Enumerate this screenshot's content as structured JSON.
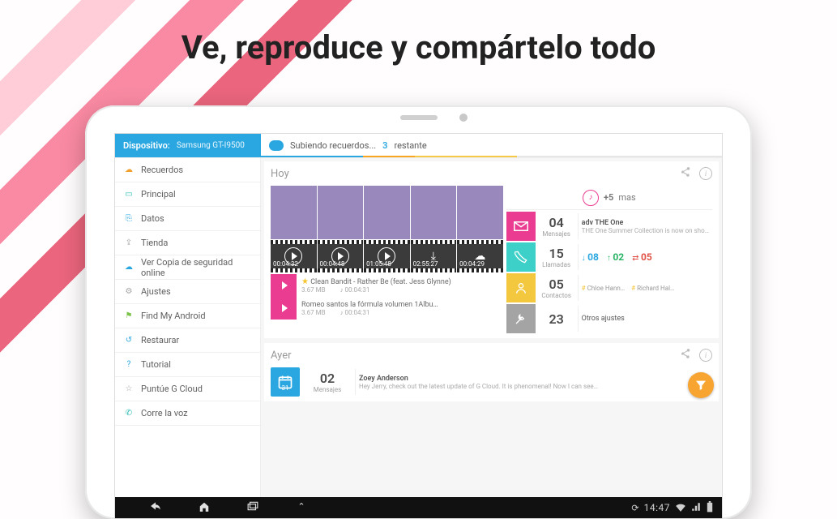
{
  "headline": "Ve, reproduce y compártelo todo",
  "header": {
    "device_label": "Dispositivo:",
    "device_name": "Samsung GT-I9500",
    "upload_prefix": "Subiendo recuerdos...",
    "upload_count": "3",
    "upload_suffix": "restante"
  },
  "sidebar": {
    "items": [
      {
        "icon": "☁",
        "color": "ico-orange",
        "label": "Recuerdos"
      },
      {
        "icon": "▭",
        "color": "ico-teal",
        "label": "Principal"
      },
      {
        "icon": "⎘",
        "color": "ico-blue",
        "label": "Datos"
      },
      {
        "icon": "⇪",
        "color": "ico-gray",
        "label": "Tienda"
      },
      {
        "icon": "☁",
        "color": "ico-blue",
        "label": "Ver Copia de seguridad online"
      },
      {
        "icon": "⚙",
        "color": "ico-gray",
        "label": "Ajustes"
      },
      {
        "icon": "⚑",
        "color": "ico-green",
        "label": "Find My Android"
      },
      {
        "icon": "↺",
        "color": "ico-blue",
        "label": "Restaurar"
      },
      {
        "icon": "?",
        "color": "ico-blue",
        "label": "Tutorial"
      },
      {
        "icon": "☆",
        "color": "ico-gray",
        "label": "Puntúe G Cloud"
      },
      {
        "icon": "✆",
        "color": "ico-teal",
        "label": "Corre la voz"
      }
    ]
  },
  "sections": {
    "today": {
      "title": "Hoy",
      "videos": [
        {
          "dur": "00:04:32"
        },
        {
          "dur": "00:04:48"
        },
        {
          "dur": "01:05:48"
        },
        {
          "dur": "02:55:27"
        },
        {
          "dur": "00:04:29"
        }
      ],
      "music": [
        {
          "star": true,
          "title": "Clean Bandit - Rather Be (feat. Jess Glynne)",
          "size": "3.67 MB",
          "dur": "00:04:31"
        },
        {
          "star": false,
          "title": "Romeo santos la fórmula volumen 1Álbu…",
          "size": "3.67 MB",
          "dur": "00:04:31"
        }
      ],
      "more_count": "+5",
      "more_label": "mas",
      "stats": {
        "messages": {
          "num": "04",
          "label": "Mensajes",
          "line1": "adv THE One",
          "line2": "THE One Summer Collection is now on sho…"
        },
        "calls": {
          "num": "15",
          "label": "Llamadas",
          "in": "08",
          "out": "02",
          "miss": "05"
        },
        "contacts": {
          "num": "05",
          "label": "Contactos",
          "tag1": "Chloe Hann…",
          "tag2": "Richard Hal…"
        },
        "settings": {
          "num": "23",
          "label": "Otros ajustes"
        }
      }
    },
    "yesterday": {
      "title": "Ayer",
      "cal_day": "31",
      "messages": {
        "num": "02",
        "label": "Mensajes",
        "from": "Zoey Anderson",
        "preview": "Hey Jerry, check out the latest update of G Cloud. It is phenomenal! Now I can see…"
      }
    }
  },
  "navbar": {
    "clock": "14:47"
  }
}
